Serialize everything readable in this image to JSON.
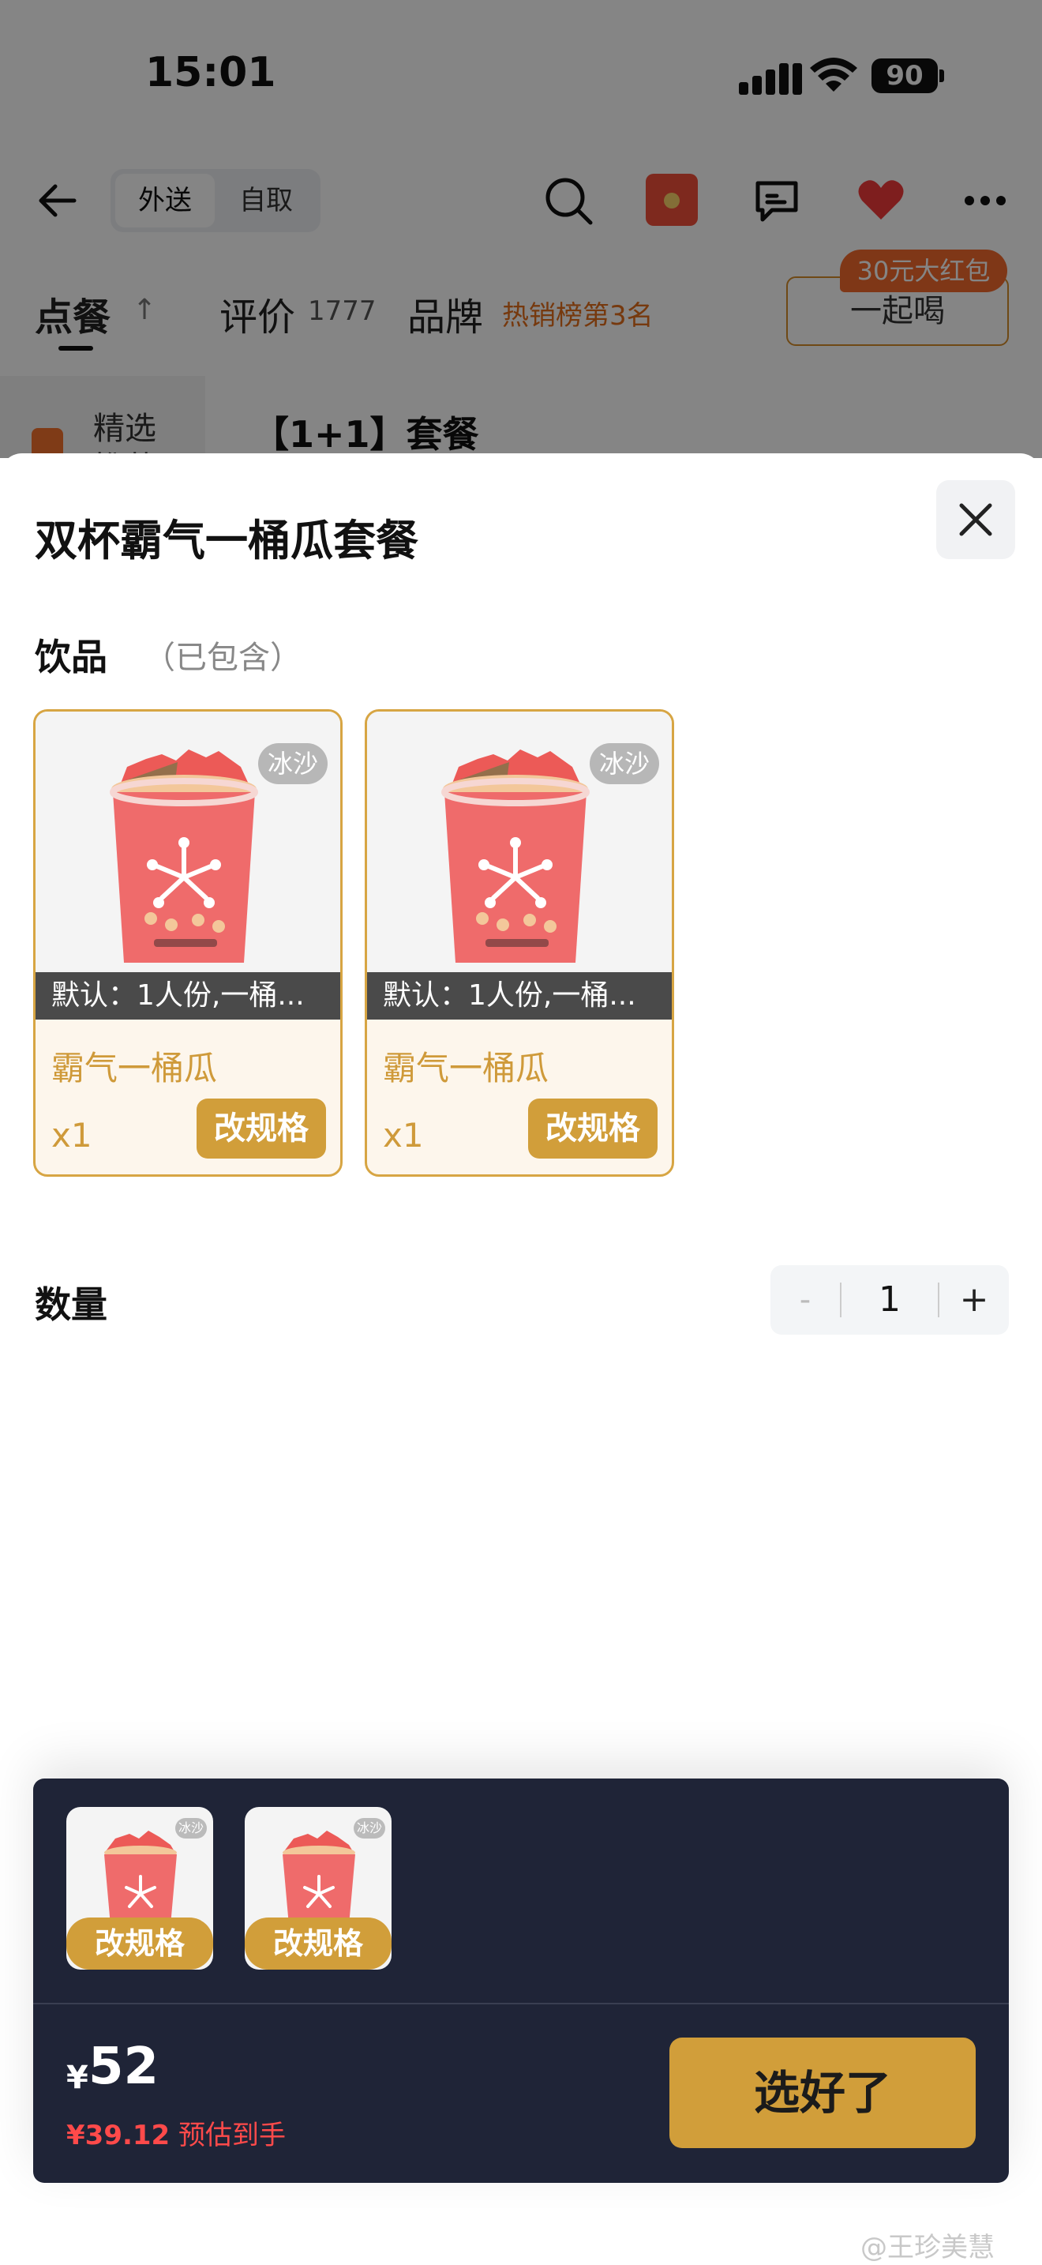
{
  "status_bar": {
    "time": "15:01",
    "battery": "90"
  },
  "nav": {
    "seg_delivery": "外送",
    "seg_pickup": "自取"
  },
  "tabs": {
    "order": "点餐",
    "order_arrow": "↑",
    "reviews": "评价",
    "reviews_count": "1777",
    "brand": "品牌",
    "brand_rank": "热销榜第3名",
    "together_button": "一起喝",
    "red_packet": "30元大红包"
  },
  "menu_bg": {
    "side_label": "精选",
    "side_label2": "推荐",
    "section_title": "【1+1】套餐"
  },
  "sheet": {
    "title": "双杯霸气一桶瓜套餐",
    "section_drinks": "饮品",
    "section_drinks_note": "（已包含）",
    "drinks": [
      {
        "badge": "冰沙",
        "default": "默认：1人份,一桶...",
        "name": "霸气一桶瓜",
        "qty": "x1",
        "change": "改规格"
      },
      {
        "badge": "冰沙",
        "default": "默认：1人份,一桶...",
        "name": "霸气一桶瓜",
        "qty": "x1",
        "change": "改规格"
      }
    ],
    "quantity_label": "数量",
    "quantity_minus": "-",
    "quantity_value": "1",
    "quantity_plus": "+"
  },
  "bottom": {
    "thumbs": [
      {
        "badge": "冰沙",
        "change": "改规格"
      },
      {
        "badge": "冰沙",
        "change": "改规格"
      }
    ],
    "currency": "¥",
    "price": "52",
    "est_value": "¥39.12",
    "est_label": "预估到手",
    "done_button": "选好了"
  },
  "watermark": "@王珍美慧",
  "colors": {
    "accent": "#d19e3a",
    "panel": "#1f2437",
    "price_red": "#ff4a4a",
    "orange": "#e36e1b"
  }
}
